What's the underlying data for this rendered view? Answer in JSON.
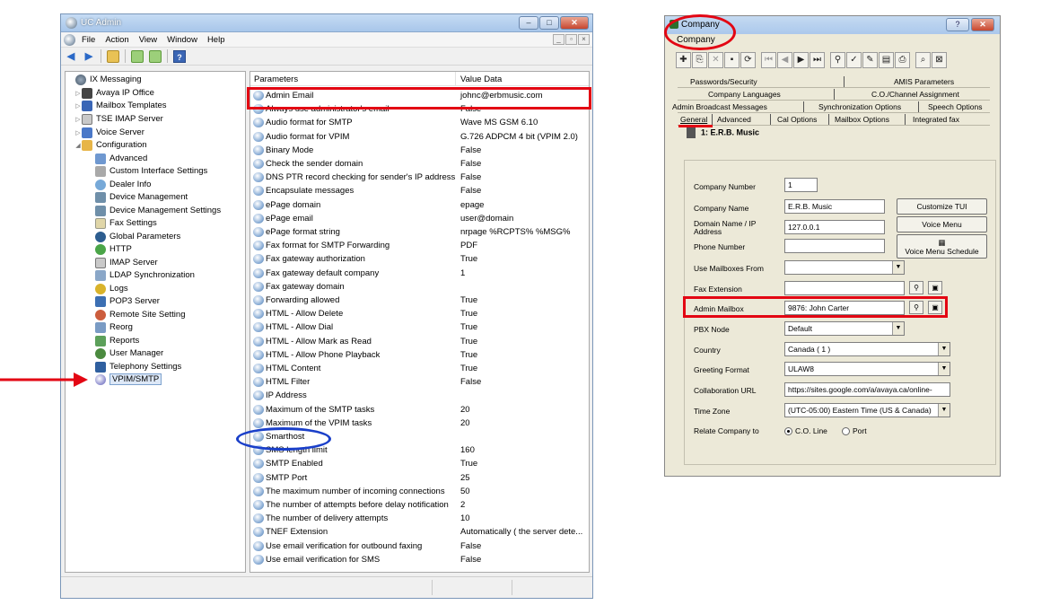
{
  "uc_admin": {
    "title": "UC Admin",
    "menus": [
      "File",
      "Action",
      "View",
      "Window",
      "Help"
    ],
    "tree": [
      {
        "label": "IX Messaging",
        "icon": "ix-messaging-icon",
        "level": 0,
        "expanded": true
      },
      {
        "label": "Avaya IP Office",
        "icon": "avaya-icon",
        "level": 1,
        "expanded": false
      },
      {
        "label": "Mailbox Templates",
        "icon": "mailbox-templates-icon",
        "level": 1,
        "expanded": false
      },
      {
        "label": "TSE IMAP Server",
        "icon": "imap-server-icon",
        "level": 1,
        "expanded": false
      },
      {
        "label": "Voice Server",
        "icon": "voice-server-icon",
        "level": 1,
        "expanded": false
      },
      {
        "label": "Configuration",
        "icon": "configuration-icon",
        "level": 1,
        "expanded": true
      },
      {
        "label": "Advanced",
        "icon": "advanced-icon",
        "level": 2
      },
      {
        "label": "Custom Interface Settings",
        "icon": "custom-interface-icon",
        "level": 2
      },
      {
        "label": "Dealer Info",
        "icon": "dealer-info-icon",
        "level": 2
      },
      {
        "label": "Device Management",
        "icon": "device-management-icon",
        "level": 2
      },
      {
        "label": "Device Management Settings",
        "icon": "device-management-settings-icon",
        "level": 2
      },
      {
        "label": "Fax Settings",
        "icon": "fax-settings-icon",
        "level": 2
      },
      {
        "label": "Global Parameters",
        "icon": "global-parameters-icon",
        "level": 2
      },
      {
        "label": "HTTP",
        "icon": "http-icon",
        "level": 2
      },
      {
        "label": "IMAP Server",
        "icon": "imap-icon",
        "level": 2
      },
      {
        "label": "LDAP Synchronization",
        "icon": "ldap-icon",
        "level": 2
      },
      {
        "label": "Logs",
        "icon": "logs-icon",
        "level": 2
      },
      {
        "label": "POP3 Server",
        "icon": "pop3-icon",
        "level": 2
      },
      {
        "label": "Remote Site Setting",
        "icon": "remote-site-icon",
        "level": 2
      },
      {
        "label": "Reorg",
        "icon": "reorg-icon",
        "level": 2
      },
      {
        "label": "Reports",
        "icon": "reports-icon",
        "level": 2
      },
      {
        "label": "User Manager",
        "icon": "user-manager-icon",
        "level": 2
      },
      {
        "label": "Telephony Settings",
        "icon": "telephony-icon",
        "level": 2
      },
      {
        "label": "VPIM/SMTP",
        "icon": "vpim-smtp-icon",
        "level": 2,
        "selected": true
      }
    ],
    "params_header": {
      "name": "Parameters",
      "value": "Value Data"
    },
    "params": [
      {
        "name": "Admin Email",
        "value": "johnc@erbmusic.com"
      },
      {
        "name": "Always use administrator's email",
        "value": "False"
      },
      {
        "name": "Audio format for SMTP",
        "value": "Wave MS GSM 6.10"
      },
      {
        "name": "Audio format for VPIM",
        "value": "G.726 ADPCM 4 bit (VPIM 2.0)"
      },
      {
        "name": "Binary Mode",
        "value": "False"
      },
      {
        "name": "Check the sender domain",
        "value": "False"
      },
      {
        "name": "DNS PTR record checking for sender's IP address",
        "value": "False"
      },
      {
        "name": "Encapsulate messages",
        "value": "False"
      },
      {
        "name": "ePage domain",
        "value": "epage"
      },
      {
        "name": "ePage email",
        "value": "user@domain"
      },
      {
        "name": "ePage format string",
        "value": "nrpage %RCPTS% %MSG%"
      },
      {
        "name": "Fax format for SMTP Forwarding",
        "value": "PDF"
      },
      {
        "name": "Fax gateway authorization",
        "value": "True"
      },
      {
        "name": "Fax gateway default company",
        "value": "1"
      },
      {
        "name": "Fax gateway domain",
        "value": ""
      },
      {
        "name": "Forwarding allowed",
        "value": "True"
      },
      {
        "name": "HTML - Allow Delete",
        "value": "True"
      },
      {
        "name": "HTML - Allow Dial",
        "value": "True"
      },
      {
        "name": "HTML - Allow Mark as Read",
        "value": "True"
      },
      {
        "name": "HTML - Allow Phone Playback",
        "value": "True"
      },
      {
        "name": "HTML Content",
        "value": "True"
      },
      {
        "name": "HTML Filter",
        "value": "False"
      },
      {
        "name": "IP Address",
        "value": ""
      },
      {
        "name": "Maximum of the SMTP tasks",
        "value": "20"
      },
      {
        "name": "Maximum of the VPIM tasks",
        "value": "20"
      },
      {
        "name": "Smarthost",
        "value": ""
      },
      {
        "name": "SMS length limit",
        "value": "160"
      },
      {
        "name": "SMTP Enabled",
        "value": "True"
      },
      {
        "name": "SMTP Port",
        "value": "25"
      },
      {
        "name": "The maximum number of incoming connections",
        "value": "50"
      },
      {
        "name": "The number of attempts before delay notification",
        "value": "2"
      },
      {
        "name": "The number of delivery attempts",
        "value": "10"
      },
      {
        "name": "TNEF Extension",
        "value": "Automatically ( the server dete..."
      },
      {
        "name": "Use email verification for outbound faxing",
        "value": "False"
      },
      {
        "name": "Use email verification for SMS",
        "value": "False"
      }
    ]
  },
  "company": {
    "title": "Company",
    "menu": "Company",
    "tabs_row1": [
      "Passwords/Security",
      "AMIS Parameters"
    ],
    "tabs_row2": [
      "Company Languages",
      "C.O./Channel Assignment"
    ],
    "tabs_row3": [
      "Admin Broadcast Messages",
      "Synchronization Options",
      "Speech Options"
    ],
    "tabs_row4": [
      "General",
      "Advanced",
      "Cal Options",
      "Mailbox Options",
      "Integrated fax"
    ],
    "header": "1: E.R.B. Music",
    "fields": {
      "company_number_label": "Company Number",
      "company_number": "1",
      "company_name_label": "Company Name",
      "company_name": "E.R.B. Music",
      "domain_label": "Domain Name / IP Address",
      "domain": "127.0.0.1",
      "phone_label": "Phone Number",
      "phone": "",
      "use_mailboxes_label": "Use Mailboxes From",
      "use_mailboxes": "",
      "fax_ext_label": "Fax Extension",
      "fax_ext": "",
      "admin_mailbox_label": "Admin Mailbox",
      "admin_mailbox": "9876: John Carter",
      "pbx_node_label": "PBX Node",
      "pbx_node": "Default",
      "country_label": "Country",
      "country": "Canada ( 1 )",
      "greeting_label": "Greeting Format",
      "greeting": "ULAW8",
      "collab_label": "Collaboration URL",
      "collab": "https://sites.google.com/a/avaya.ca/online-",
      "timezone_label": "Time Zone",
      "timezone": "(UTC-05:00) Eastern Time (US & Canada)",
      "relate_label": "Relate Company to",
      "relate_opt1": "C.O. Line",
      "relate_opt2": "Port"
    },
    "buttons": {
      "customize_tui": "Customize TUI",
      "voice_menu": "Voice Menu",
      "voice_menu_schedule": "Voice Menu Schedule"
    }
  },
  "colors": {
    "highlight_red": "#e30613",
    "highlight_blue": "#1a3fc9"
  }
}
